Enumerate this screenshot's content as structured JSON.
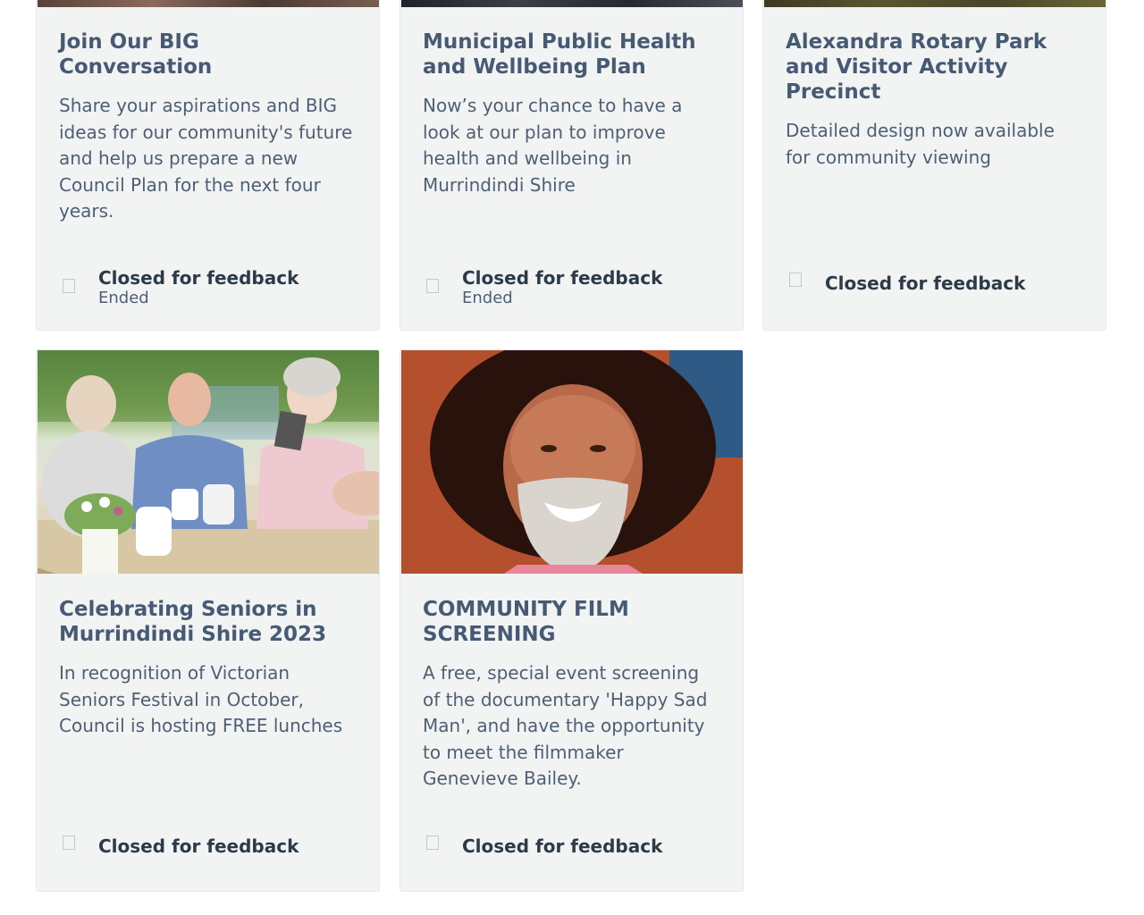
{
  "cards": [
    {
      "title": "Join Our BIG Conversation",
      "description": "Share your aspirations and BIG ideas for our community's future and help us prepare a new Council Plan for the next four years.",
      "status": "Closed for feedback",
      "status_sub": "Ended"
    },
    {
      "title": "Municipal Public Health and Wellbeing Plan",
      "description": "Now’s your chance to have a look at our plan to improve health and wellbeing in Murrindindi Shire",
      "status": "Closed for feedback",
      "status_sub": "Ended"
    },
    {
      "title": "Alexandra Rotary Park and Visitor Activity Precinct",
      "description": "Detailed design now available for community viewing",
      "status": "Closed for feedback"
    },
    {
      "title": "Celebrating Seniors in Murrindindi Shire 2023",
      "description": "In recognition of Victorian Seniors Festival in October, Council is hosting FREE lunches",
      "status": "Closed for feedback",
      "image_alt": "seniors-lunch-photo"
    },
    {
      "title": "COMMUNITY FILM SCREENING",
      "description": "A free, special event screening of the documentary 'Happy Sad Man', and have the opportunity to meet the filmmaker Genevieve Bailey.",
      "status": "Closed for feedback",
      "image_alt": "filmmaker-portrait-photo"
    }
  ],
  "colors": {
    "card_bg": "#f2f4f4",
    "title": "#475a73",
    "text": "#4e5f73",
    "status": "#2d3a48"
  }
}
